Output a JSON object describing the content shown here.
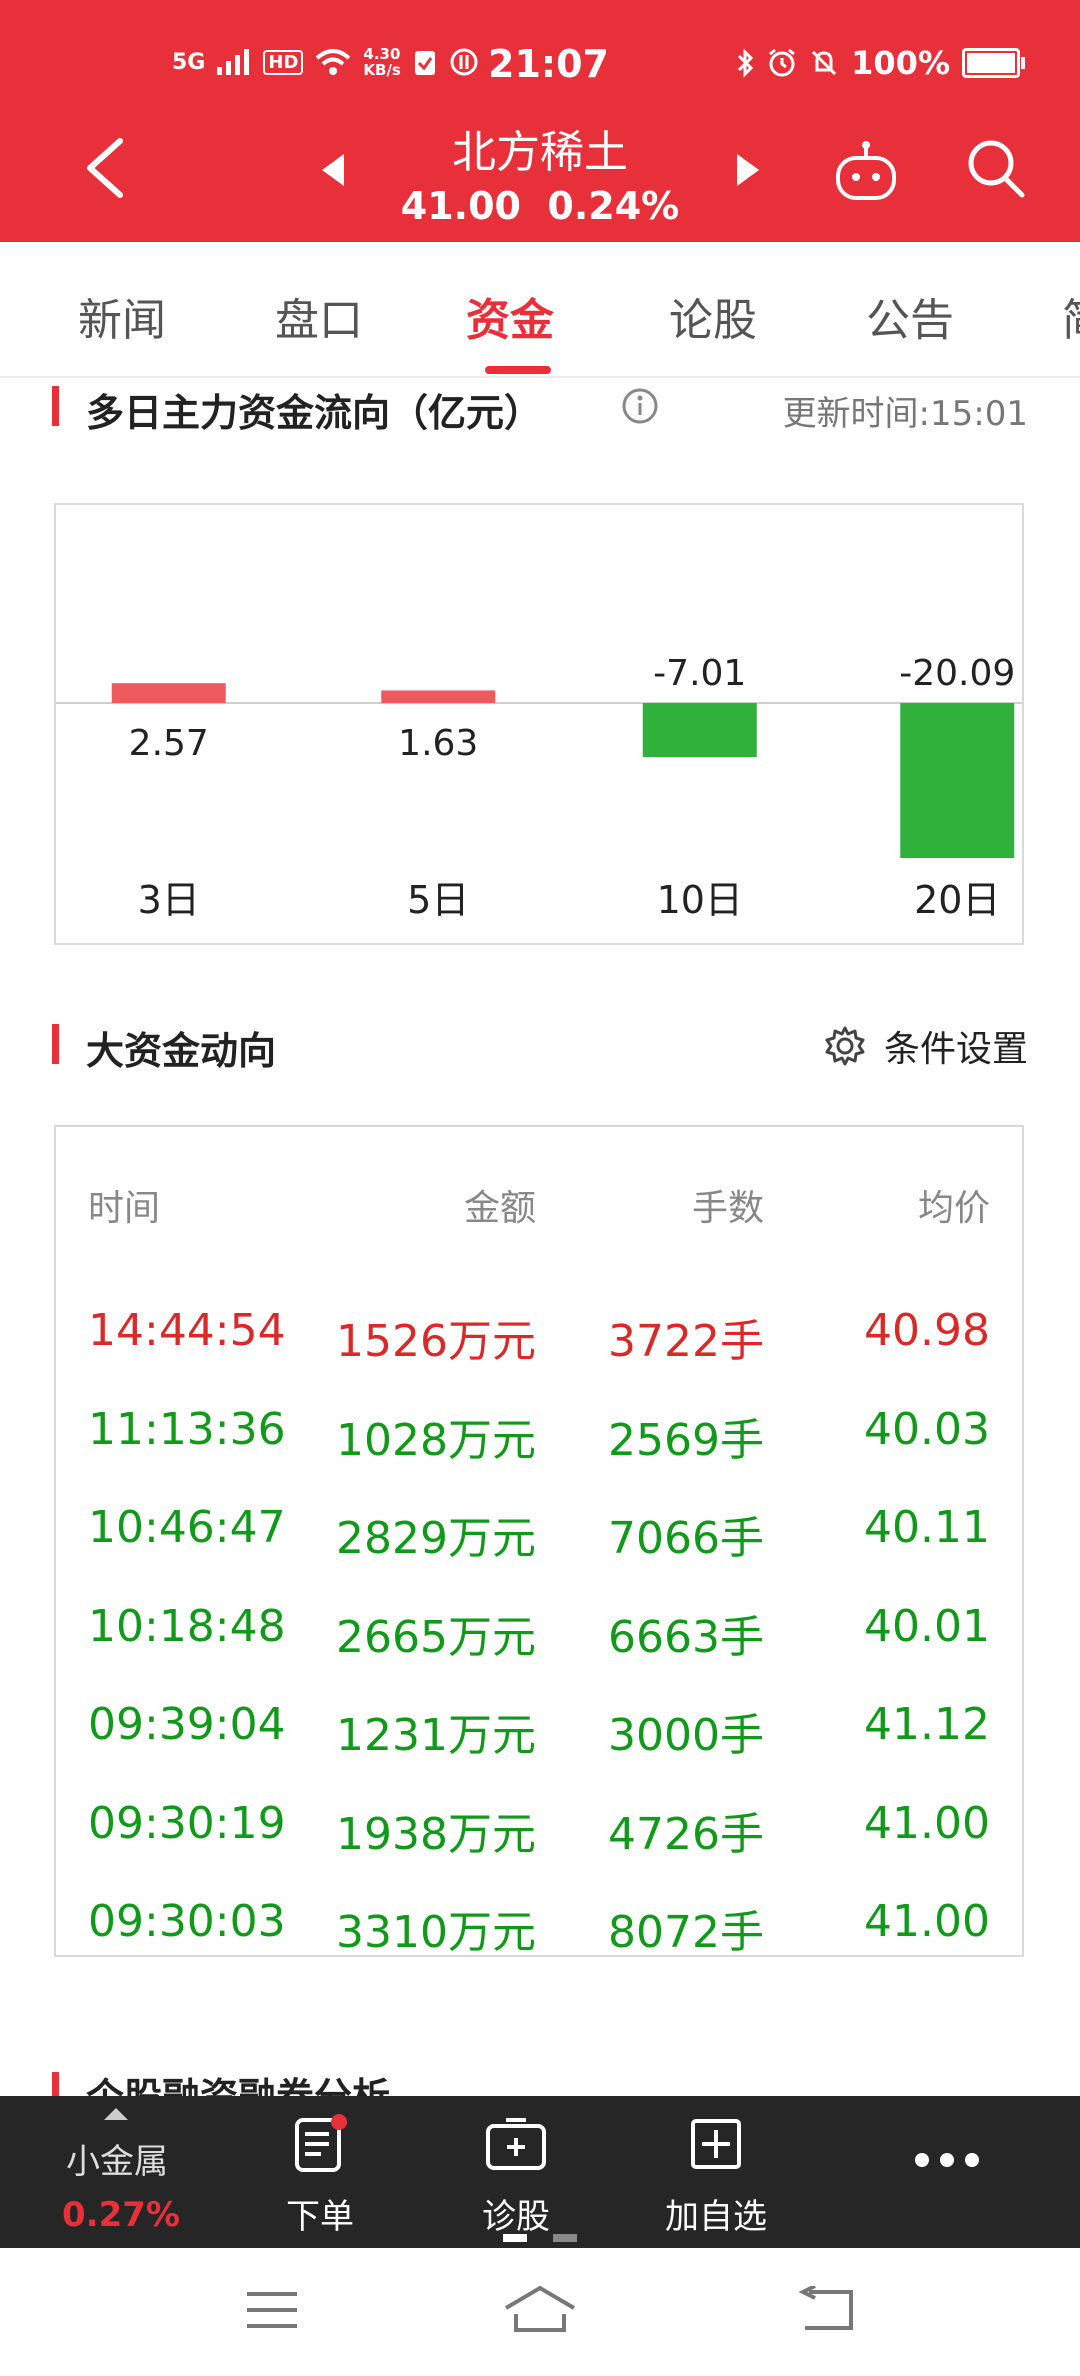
{
  "status_bar": {
    "network": "5G",
    "hd": "HD",
    "speed_value": "4.30",
    "speed_unit": "KB/s",
    "time": "21:07",
    "battery": "100%"
  },
  "nav": {
    "stock_name": "北方稀土",
    "price_line": "41.00  0.24%"
  },
  "tabs": [
    {
      "label": "新闻"
    },
    {
      "label": "盘口"
    },
    {
      "label": "资金"
    },
    {
      "label": "论股"
    },
    {
      "label": "公告"
    },
    {
      "label": "简"
    }
  ],
  "fund_flow": {
    "title": "多日主力资金流向（亿元）",
    "update_time": "更新时间:15:01"
  },
  "chart_data": {
    "type": "bar",
    "categories": [
      "3日",
      "5日",
      "10日",
      "20日"
    ],
    "values": [
      2.57,
      1.63,
      -7.01,
      -20.09
    ],
    "value_labels": [
      "2.57",
      "1.63",
      "-7.01",
      "-20.09"
    ],
    "positive_color": "#ee5a5e",
    "negative_color": "#2fb13b",
    "grid": false
  },
  "big_funds": {
    "title": "大资金动向",
    "settings_label": "条件设置",
    "columns": [
      "时间",
      "金额",
      "手数",
      "均价"
    ],
    "rows": [
      {
        "time": "14:44:54",
        "amount": "1526万元",
        "lots": "3722手",
        "avg": "40.98",
        "color": "#d92a2a"
      },
      {
        "time": "11:13:36",
        "amount": "1028万元",
        "lots": "2569手",
        "avg": "40.03",
        "color": "#119a1a"
      },
      {
        "time": "10:46:47",
        "amount": "2829万元",
        "lots": "7066手",
        "avg": "40.11",
        "color": "#119a1a"
      },
      {
        "time": "10:18:48",
        "amount": "2665万元",
        "lots": "6663手",
        "avg": "40.01",
        "color": "#119a1a"
      },
      {
        "time": "09:39:04",
        "amount": "1231万元",
        "lots": "3000手",
        "avg": "41.12",
        "color": "#119a1a"
      },
      {
        "time": "09:30:19",
        "amount": "1938万元",
        "lots": "4726手",
        "avg": "41.00",
        "color": "#119a1a"
      },
      {
        "time": "09:30:03",
        "amount": "3310万元",
        "lots": "8072手",
        "avg": "41.00",
        "color": "#119a1a"
      }
    ]
  },
  "next_section": {
    "title": "个股融资融券分析"
  },
  "toolbar": {
    "metal_name": "小金属",
    "metal_pct": "0.27%",
    "order_label": "下单",
    "diagnose_label": "诊股",
    "watchlist_label": "加自选"
  },
  "colors": {
    "brand_red": "#e8303a",
    "toolbar_bg": "#262626"
  }
}
